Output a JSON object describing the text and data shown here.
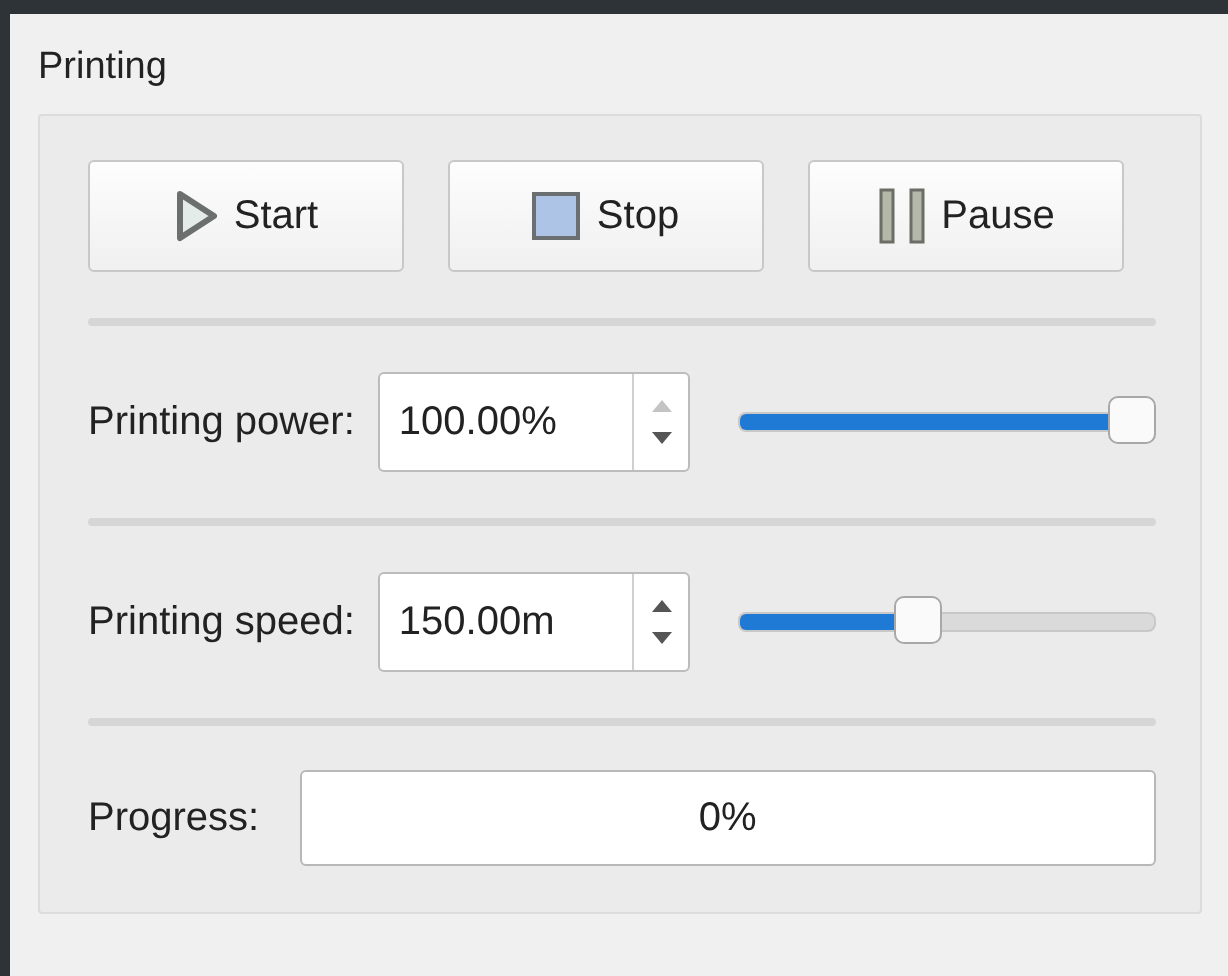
{
  "group": {
    "title": "Printing"
  },
  "buttons": [
    {
      "kind": "play",
      "label": "Start"
    },
    {
      "kind": "stop",
      "label": "Stop"
    },
    {
      "kind": "pause",
      "label": "Pause"
    }
  ],
  "settings": [
    {
      "label": "Printing power:",
      "value": "100.00%",
      "level": 1.0
    },
    {
      "label": "Printing speed:",
      "value": "150.00m",
      "level": 0.42
    }
  ],
  "progress": {
    "label": "Progress:",
    "text": "0%",
    "level": 0
  }
}
